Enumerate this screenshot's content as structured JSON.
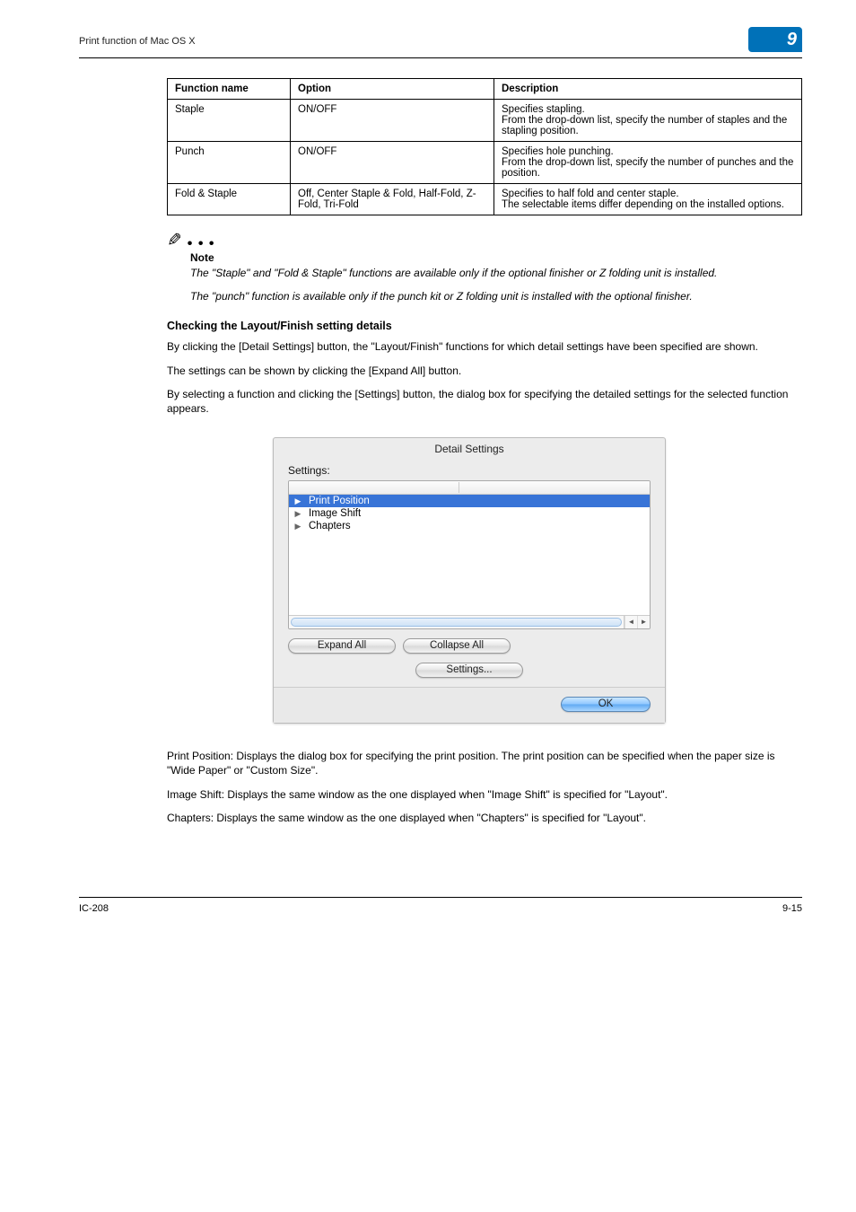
{
  "header": {
    "section_title": "Print function of Mac OS X",
    "chapter_number": "9"
  },
  "table": {
    "headers": {
      "fn": "Function name",
      "op": "Option",
      "desc": "Description"
    },
    "rows": [
      {
        "fn": "Staple",
        "op": "ON/OFF",
        "desc": "Specifies stapling.\nFrom the drop-down list, specify the number of staples and the stapling position."
      },
      {
        "fn": "Punch",
        "op": "ON/OFF",
        "desc": "Specifies hole punching.\nFrom the drop-down list, specify the number of punches and the position."
      },
      {
        "fn": "Fold & Staple",
        "op": "Off, Center Staple & Fold, Half-Fold, Z-Fold, Tri-Fold",
        "desc": "Specifies to half fold and center staple.\nThe selectable items differ depending on the installed options."
      }
    ]
  },
  "note": {
    "label": "Note",
    "p1": "The \"Staple\" and \"Fold & Staple\" functions are available only if the optional finisher or Z folding unit is installed.",
    "p2": "The \"punch\" function is available only if the punch kit or Z folding unit is installed with the optional finisher."
  },
  "subheading": "Checking the Layout/Finish setting details",
  "paras": {
    "p1": "By clicking the [Detail Settings] button, the \"Layout/Finish\" functions for which detail settings have been specified are shown.",
    "p2": "The settings can be shown by clicking the [Expand All] button.",
    "p3": "By selecting a function and clicking the [Settings] button, the dialog box for specifying the detailed settings for the selected function appears."
  },
  "dialog": {
    "title": "Detail Settings",
    "label": "Settings:",
    "items": [
      "Print Position",
      "Image Shift",
      "Chapters"
    ],
    "buttons": {
      "expand": "Expand All",
      "collapse": "Collapse All",
      "settings": "Settings...",
      "ok": "OK"
    }
  },
  "descriptions": {
    "d1": "Print Position: Displays the dialog box for specifying the print position. The print position can be specified when the paper size is \"Wide Paper\" or \"Custom Size\".",
    "d2": "Image Shift: Displays the same window as the one displayed when \"Image Shift\" is specified for \"Layout\".",
    "d3": "Chapters: Displays the same window as the one displayed when \"Chapters\" is specified for \"Layout\"."
  },
  "footer": {
    "left": "IC-208",
    "right": "9-15"
  }
}
